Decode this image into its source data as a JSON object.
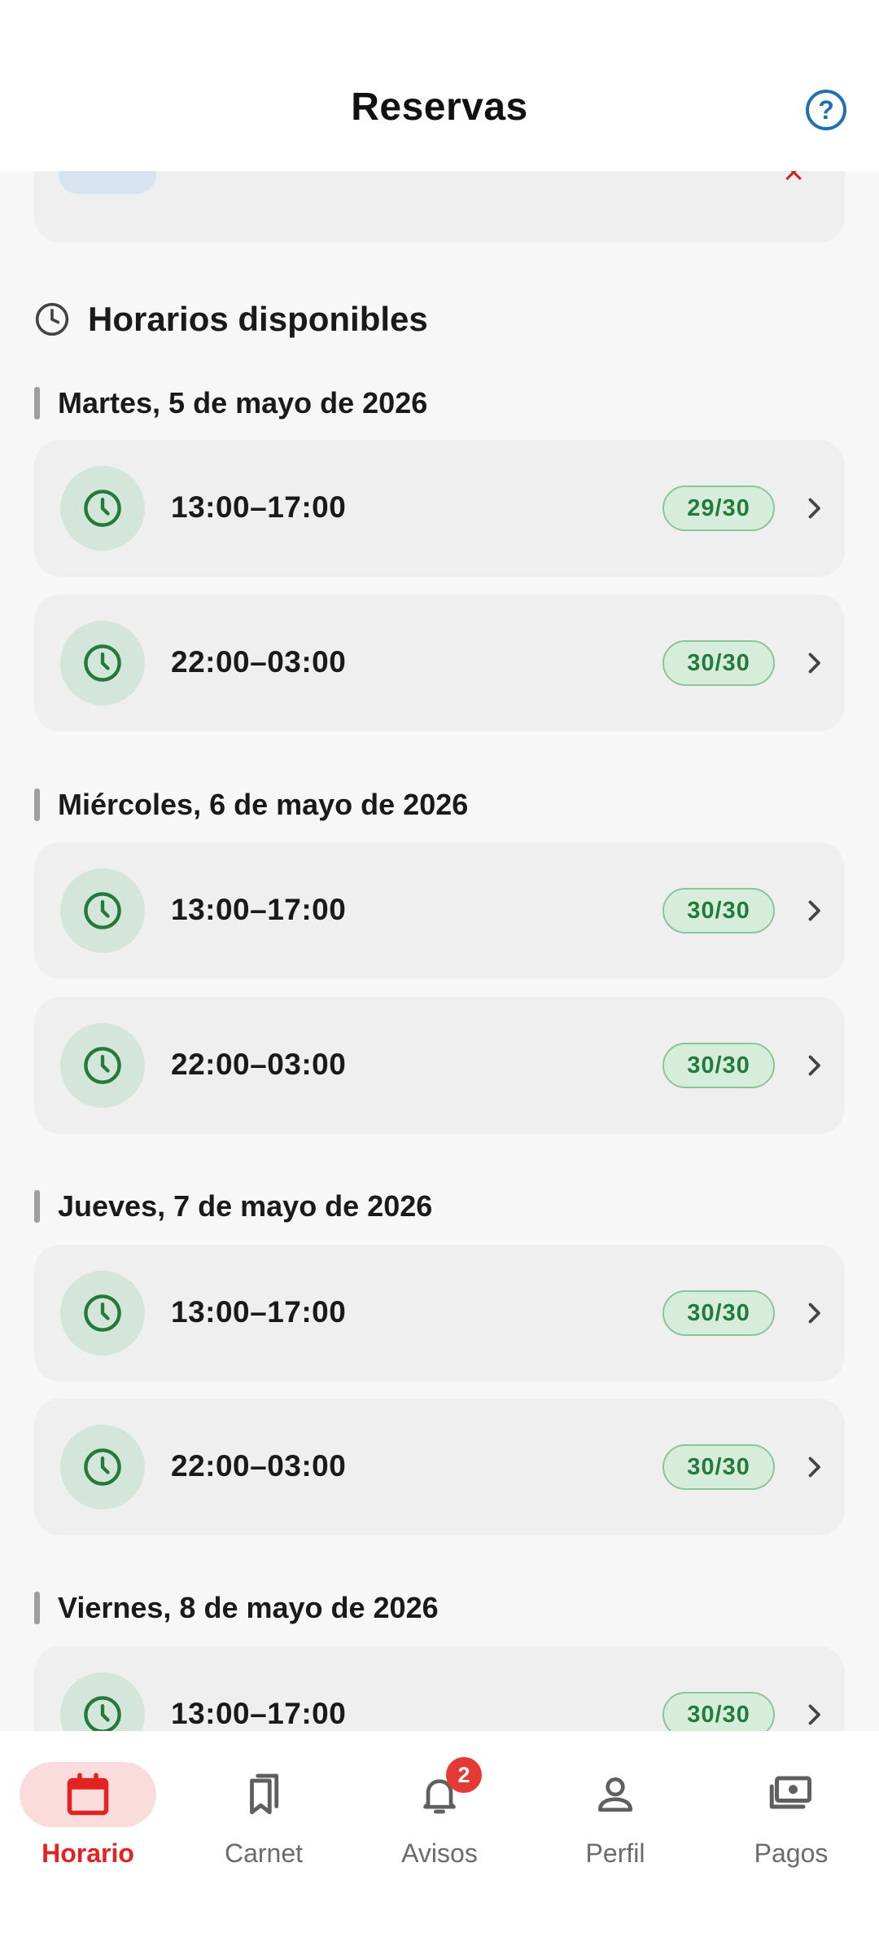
{
  "header": {
    "title": "Reservas",
    "help_icon": "help-circle-icon"
  },
  "accent_color": "#237a3b",
  "section": {
    "title": "Horarios disponibles",
    "icon": "clock-outline-icon"
  },
  "days": [
    {
      "label": "Martes, 5 de mayo de 2026",
      "slots": [
        {
          "time": "13:00–17:00",
          "capacity": "29/30"
        },
        {
          "time": "22:00–03:00",
          "capacity": "30/30"
        }
      ]
    },
    {
      "label": "Miércoles, 6 de mayo de 2026",
      "slots": [
        {
          "time": "13:00–17:00",
          "capacity": "30/30"
        },
        {
          "time": "22:00–03:00",
          "capacity": "30/30"
        }
      ]
    },
    {
      "label": "Jueves, 7 de mayo de 2026",
      "slots": [
        {
          "time": "13:00–17:00",
          "capacity": "30/30"
        },
        {
          "time": "22:00–03:00",
          "capacity": "30/30"
        }
      ]
    },
    {
      "label": "Viernes, 8 de mayo de 2026",
      "slots": [
        {
          "time": "13:00–17:00",
          "capacity": "30/30"
        }
      ]
    }
  ],
  "nav": {
    "items": [
      {
        "label": "Horario",
        "icon": "calendar-icon",
        "active": true
      },
      {
        "label": "Carnet",
        "icon": "bookmarks-icon"
      },
      {
        "label": "Avisos",
        "icon": "bell-icon",
        "badge": "2"
      },
      {
        "label": "Perfil",
        "icon": "person-icon"
      },
      {
        "label": "Pagos",
        "icon": "payments-icon"
      }
    ]
  }
}
